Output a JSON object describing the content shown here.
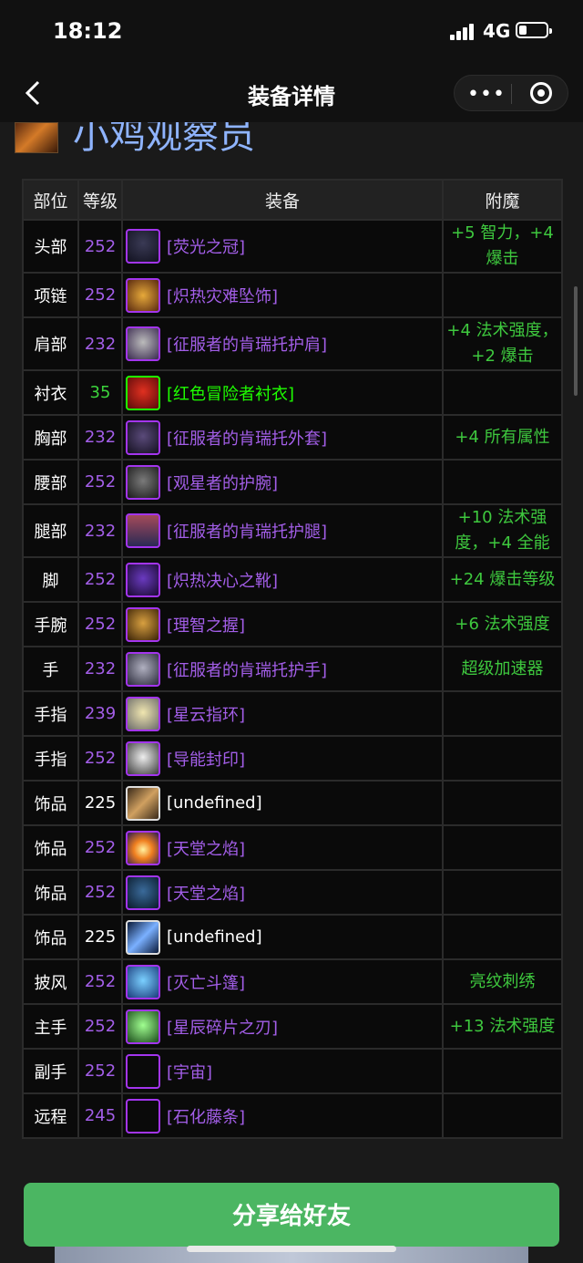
{
  "status": {
    "time": "18:12",
    "network": "4G"
  },
  "nav": {
    "title": "装备详情"
  },
  "character": {
    "name": "小鸡观察员"
  },
  "table": {
    "headers": [
      "部位",
      "等级",
      "装备",
      "附魔"
    ],
    "rows": [
      {
        "slot": "头部",
        "level": "252",
        "item": "[荧光之冠]",
        "enchant": "+5 智力，+4 爆击",
        "quality": "epic"
      },
      {
        "slot": "项链",
        "level": "252",
        "item": "[炽热灾难坠饰]",
        "enchant": "",
        "quality": "epic"
      },
      {
        "slot": "肩部",
        "level": "232",
        "item": "[征服者的肯瑞托护肩]",
        "enchant": "+4 法术强度，+2 爆击",
        "quality": "epic"
      },
      {
        "slot": "衬衣",
        "level": "35",
        "item": "[红色冒险者衬衣]",
        "enchant": "",
        "quality": "green"
      },
      {
        "slot": "胸部",
        "level": "232",
        "item": "[征服者的肯瑞托外套]",
        "enchant": "+4 所有属性",
        "quality": "epic"
      },
      {
        "slot": "腰部",
        "level": "252",
        "item": "[观星者的护腕]",
        "enchant": "",
        "quality": "epic"
      },
      {
        "slot": "腿部",
        "level": "232",
        "item": "[征服者的肯瑞托护腿]",
        "enchant": "+10 法术强度，+4 全能",
        "quality": "epic"
      },
      {
        "slot": "脚",
        "level": "252",
        "item": "[炽热决心之靴]",
        "enchant": "+24 爆击等级",
        "quality": "epic"
      },
      {
        "slot": "手腕",
        "level": "252",
        "item": "[理智之握]",
        "enchant": "+6 法术强度",
        "quality": "epic"
      },
      {
        "slot": "手",
        "level": "232",
        "item": "[征服者的肯瑞托护手]",
        "enchant": "超级加速器",
        "quality": "epic"
      },
      {
        "slot": "手指",
        "level": "239",
        "item": "[星云指环]",
        "enchant": "",
        "quality": "epic"
      },
      {
        "slot": "手指",
        "level": "252",
        "item": "[导能封印]",
        "enchant": "",
        "quality": "epic"
      },
      {
        "slot": "饰品",
        "level": "225",
        "item": "[undefined]",
        "enchant": "",
        "quality": "white"
      },
      {
        "slot": "饰品",
        "level": "252",
        "item": "[天堂之焰]",
        "enchant": "",
        "quality": "epic"
      },
      {
        "slot": "饰品",
        "level": "252",
        "item": "[天堂之焰]",
        "enchant": "",
        "quality": "epic"
      },
      {
        "slot": "饰品",
        "level": "225",
        "item": "[undefined]",
        "enchant": "",
        "quality": "white"
      },
      {
        "slot": "披风",
        "level": "252",
        "item": "[灭亡斗篷]",
        "enchant": "亮纹刺绣",
        "quality": "epic"
      },
      {
        "slot": "主手",
        "level": "252",
        "item": "[星辰碎片之刃]",
        "enchant": "+13 法术强度",
        "quality": "epic"
      },
      {
        "slot": "副手",
        "level": "252",
        "item": "[宇宙]",
        "enchant": "",
        "quality": "epic"
      },
      {
        "slot": "远程",
        "level": "245",
        "item": "[石化藤条]",
        "enchant": "",
        "quality": "epic"
      }
    ]
  },
  "share_button": "分享给好友",
  "colors": {
    "epic": "#a335ee",
    "green": "#1eff00",
    "enchant": "#3ec83e",
    "share": "#4bb662"
  }
}
